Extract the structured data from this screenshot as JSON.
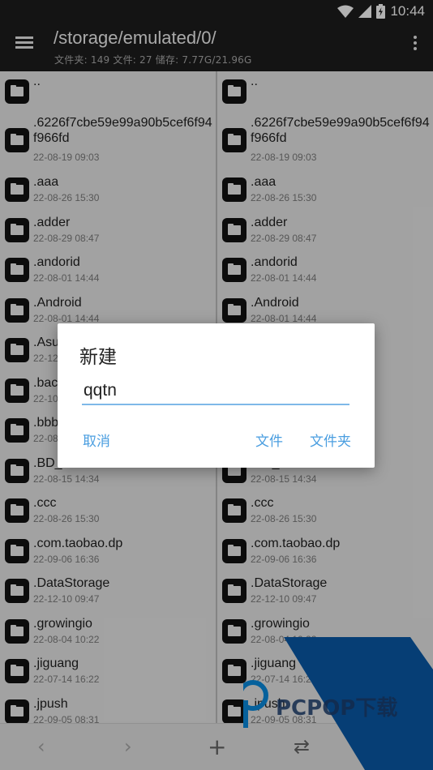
{
  "status_bar": {
    "time": "10:44",
    "icons": [
      "wifi-icon",
      "signal-icon",
      "battery-icon"
    ]
  },
  "toolbar": {
    "title": "/storage/emulated/0/",
    "subtitle": "文件夹: 149  文件: 27  储存: 7.77G/21.96G",
    "icons": [
      "menu-icon",
      "more-vert-icon"
    ]
  },
  "files": [
    {
      "name": "..",
      "date": ""
    },
    {
      "name": ".6226f7cbe59e99a90b5cef6f94f966fd",
      "date": "22-08-19 09:03"
    },
    {
      "name": ".aaa",
      "date": "22-08-26 15:30"
    },
    {
      "name": ".adder",
      "date": "22-08-29 08:47"
    },
    {
      "name": ".andorid",
      "date": "22-08-01 14:44"
    },
    {
      "name": ".Android",
      "date": "22-08-01 14:44"
    },
    {
      "name": ".Asu",
      "date": "22-12"
    },
    {
      "name": ".bac",
      "date": "22-10"
    },
    {
      "name": ".bbb",
      "date": "22-08"
    },
    {
      "name": ".BD_",
      "date": "22-08-15 14:34"
    },
    {
      "name": ".ccc",
      "date": "22-08-26 15:30"
    },
    {
      "name": ".com.taobao.dp",
      "date": "22-09-06 16:36"
    },
    {
      "name": ".DataStorage",
      "date": "22-12-10 09:47"
    },
    {
      "name": ".growingio",
      "date": "22-08-04 10:22"
    },
    {
      "name": ".jiguang",
      "date": "22-07-14 16:22"
    },
    {
      "name": ".jpush",
      "date": "22-09-05 08:31"
    }
  ],
  "bottom_bar": {
    "back": "‹",
    "forward": "›",
    "add": "+",
    "swap": "⇄"
  },
  "dialog": {
    "title": "新建",
    "input_value": "qqtn",
    "cancel": "取消",
    "file": "文件",
    "folder": "文件夹"
  },
  "watermark": {
    "text": "PCPOP下载",
    "colors": {
      "blue": "#0a5aa8",
      "text": "#1c3d6e"
    }
  },
  "colors": {
    "toolbar_bg": "#1d1d1d",
    "accent": "#4a9ee0",
    "input_underline": "#7eb8e8"
  }
}
